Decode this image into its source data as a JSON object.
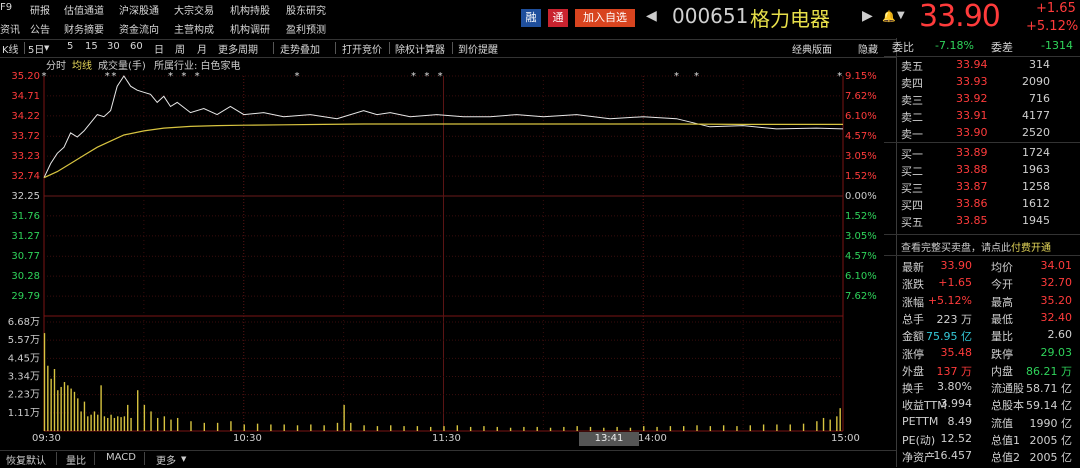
{
  "top_menu": {
    "row1": [
      "F9",
      "研报",
      "估值通道",
      "沪深股通",
      "大宗交易",
      "机构持股",
      "股东研究"
    ],
    "row2": [
      "资讯",
      "公告",
      "财务摘要",
      "资金流向",
      "主营构成",
      "机构调研",
      "盈利预测"
    ]
  },
  "header": {
    "badge_rong": "融",
    "badge_tong": "通",
    "add_watch": "加入自选",
    "code": "000651",
    "name": "格力电器",
    "price": "33.90",
    "change": "+1.65",
    "change_pct": "+5.12%",
    "colors": {
      "up": "#ff3b3b",
      "down": "#2fd35a",
      "badge_rong": "#1f4f9c",
      "badge_tong": "#c9232f",
      "add_watch": "#d8441f"
    }
  },
  "toolbar": {
    "items": [
      "K线",
      "5日",
      "5",
      "15",
      "30",
      "60",
      "日",
      "周",
      "月",
      "更多周期",
      "走势叠加",
      "打开竞价",
      "除权计算器",
      "到价提醒"
    ],
    "right_items": [
      "经典版面",
      "隐藏"
    ]
  },
  "chart_legend": {
    "items": [
      "分时",
      "均线",
      "成交量(手)",
      "所属行业: 白色家电"
    ]
  },
  "chart_data": {
    "type": "line",
    "title": "",
    "x_ticks": [
      "09:30",
      "10:30",
      "11:30",
      "14:00",
      "15:00"
    ],
    "cursor_time": "13:41",
    "price_axis_left": [
      "35.20",
      "34.71",
      "34.22",
      "33.72",
      "33.23",
      "32.74",
      "32.25",
      "31.76",
      "31.27",
      "30.77",
      "30.28",
      "29.79"
    ],
    "pct_axis_right": [
      "9.15%",
      "7.62%",
      "6.10%",
      "4.57%",
      "3.05%",
      "1.52%",
      "0.00%",
      "1.52%",
      "3.05%",
      "4.57%",
      "6.10%",
      "7.62%"
    ],
    "ylim": [
      29.3,
      35.2
    ],
    "prev_close": 32.25,
    "volume_axis": [
      "6.68万",
      "5.57万",
      "4.45万",
      "3.34万",
      "2.23万",
      "1.11万"
    ],
    "volume_max": 66800,
    "series": [
      {
        "name": "",
        "color": "#e8e8e8",
        "x": [
          0,
          2,
          4,
          6,
          8,
          10,
          12,
          14,
          16,
          18,
          20,
          22,
          24,
          26,
          28,
          30,
          32,
          34,
          36,
          38,
          40,
          44,
          48,
          52,
          56,
          60,
          66,
          72,
          80,
          88,
          96,
          100,
          104,
          110,
          118,
          126,
          134,
          142,
          150,
          160,
          170,
          180,
          190,
          200,
          210,
          220,
          232,
          240
        ],
        "values": [
          32.7,
          33.05,
          33.3,
          33.45,
          33.8,
          33.7,
          33.85,
          34.05,
          34.25,
          34.2,
          34.35,
          34.95,
          35.2,
          34.95,
          34.85,
          34.8,
          34.75,
          34.55,
          34.7,
          34.45,
          34.55,
          34.3,
          34.4,
          34.25,
          34.45,
          34.25,
          34.3,
          34.2,
          34.25,
          34.15,
          34.35,
          34.25,
          34.3,
          34.2,
          34.25,
          34.2,
          34.2,
          34.25,
          34.2,
          34.25,
          34.15,
          34.2,
          34.15,
          33.95,
          33.98,
          33.9,
          33.92,
          33.9
        ]
      },
      {
        "name": "",
        "color": "#d8c440",
        "x": [
          0,
          4,
          8,
          12,
          16,
          20,
          24,
          30,
          36,
          44,
          52,
          60,
          72,
          84,
          96,
          110,
          130,
          150,
          170,
          190,
          210,
          230,
          240
        ],
        "values": [
          32.7,
          32.85,
          33.05,
          33.25,
          33.45,
          33.6,
          33.75,
          33.85,
          33.92,
          33.96,
          33.98,
          33.99,
          34.0,
          34.01,
          34.02,
          34.02,
          34.02,
          34.02,
          34.02,
          34.02,
          34.01,
          34.01,
          34.01
        ]
      }
    ],
    "volume": {
      "x": [
        0,
        1,
        2,
        3,
        4,
        5,
        6,
        7,
        8,
        9,
        10,
        11,
        12,
        13,
        14,
        15,
        16,
        17,
        18,
        19,
        20,
        21,
        22,
        23,
        24,
        25,
        26,
        28,
        30,
        32,
        34,
        36,
        38,
        40,
        44,
        48,
        52,
        56,
        60,
        64,
        68,
        72,
        76,
        80,
        84,
        88,
        90,
        92,
        96,
        100,
        104,
        108,
        112,
        116,
        120,
        124,
        128,
        132,
        136,
        140,
        144,
        148,
        152,
        156,
        160,
        164,
        168,
        172,
        176,
        180,
        184,
        188,
        192,
        196,
        200,
        204,
        208,
        212,
        216,
        220,
        224,
        228,
        232,
        234,
        236,
        238,
        239
      ],
      "values": [
        60000,
        40000,
        32000,
        38000,
        25000,
        27000,
        30000,
        28000,
        26000,
        24000,
        20000,
        12000,
        18000,
        9000,
        10000,
        12000,
        10000,
        28000,
        9000,
        8000,
        10000,
        8000,
        9000,
        8500,
        9000,
        16000,
        8000,
        25000,
        16000,
        12000,
        8000,
        9000,
        7000,
        8000,
        6000,
        5000,
        5000,
        6000,
        4000,
        4500,
        4000,
        4000,
        3500,
        4000,
        3500,
        5000,
        16000,
        5000,
        3500,
        3000,
        3500,
        3000,
        3000,
        2500,
        3000,
        3500,
        2500,
        3000,
        2500,
        2000,
        2500,
        2500,
        2000,
        2500,
        3000,
        2500,
        2000,
        2500,
        2000,
        3000,
        2500,
        3000,
        3000,
        3500,
        3000,
        3500,
        3000,
        3500,
        4000,
        4000,
        4000,
        4500,
        6000,
        8000,
        7000,
        9000,
        14000
      ]
    }
  },
  "order_book": {
    "webi_label": "委比",
    "webi_value": "-7.18%",
    "weicha_label": "委差",
    "weicha_value": "-1314",
    "sells": [
      {
        "label": "卖五",
        "price": "33.94",
        "vol": "314"
      },
      {
        "label": "卖四",
        "price": "33.93",
        "vol": "2090"
      },
      {
        "label": "卖三",
        "price": "33.92",
        "vol": "716"
      },
      {
        "label": "卖二",
        "price": "33.91",
        "vol": "4177"
      },
      {
        "label": "卖一",
        "price": "33.90",
        "vol": "2520"
      }
    ],
    "buys": [
      {
        "label": "买一",
        "price": "33.89",
        "vol": "1724"
      },
      {
        "label": "买二",
        "price": "33.88",
        "vol": "1963"
      },
      {
        "label": "买三",
        "price": "33.87",
        "vol": "1258"
      },
      {
        "label": "买四",
        "price": "33.86",
        "vol": "1612"
      },
      {
        "label": "买五",
        "price": "33.85",
        "vol": "1945"
      }
    ],
    "promo": {
      "text": "查看完整买卖盘，请点此",
      "link": "付费开通"
    }
  },
  "stats": [
    [
      {
        "l": "最新",
        "v": "33.90",
        "c": "red"
      },
      {
        "l": "均价",
        "v": "34.01",
        "c": "red"
      }
    ],
    [
      {
        "l": "涨跌",
        "v": "+1.65",
        "c": "red"
      },
      {
        "l": "今开",
        "v": "32.70",
        "c": "red"
      }
    ],
    [
      {
        "l": "涨幅",
        "v": "+5.12%",
        "c": "red"
      },
      {
        "l": "最高",
        "v": "35.20",
        "c": "red"
      }
    ],
    [
      {
        "l": "总手",
        "v": "223 万",
        "c": "wht"
      },
      {
        "l": "最低",
        "v": "32.40",
        "c": "red"
      }
    ],
    [
      {
        "l": "金额",
        "v": "75.95 亿",
        "c": "cyn"
      },
      {
        "l": "量比",
        "v": "2.60",
        "c": "wht"
      }
    ],
    [
      {
        "l": "涨停",
        "v": "35.48",
        "c": "red"
      },
      {
        "l": "跌停",
        "v": "29.03",
        "c": "grn"
      }
    ],
    [
      {
        "l": "外盘",
        "v": "137 万",
        "c": "red"
      },
      {
        "l": "内盘",
        "v": "86.21 万",
        "c": "grn"
      }
    ],
    [
      {
        "l": "换手",
        "v": "3.80%",
        "c": "wht"
      },
      {
        "l": "流通股",
        "v": "58.71 亿",
        "c": "wht"
      }
    ],
    [
      {
        "l": "收益TTM",
        "v": "3.994",
        "c": "wht"
      },
      {
        "l": "总股本",
        "v": "59.14 亿",
        "c": "wht"
      }
    ],
    [
      {
        "l": "PETTM",
        "v": "8.49",
        "c": "wht"
      },
      {
        "l": "流值",
        "v": "1990 亿",
        "c": "wht"
      }
    ],
    [
      {
        "l": "PE(动)",
        "v": "12.52",
        "c": "wht"
      },
      {
        "l": "总值1",
        "v": "2005 亿",
        "c": "wht"
      }
    ],
    [
      {
        "l": "净资产",
        "v": "16.457",
        "c": "wht"
      },
      {
        "l": "总值2",
        "v": "2005 亿",
        "c": "wht"
      }
    ]
  ],
  "bottom_tabs": [
    "恢复默认",
    "量比",
    "MACD",
    "更多"
  ]
}
